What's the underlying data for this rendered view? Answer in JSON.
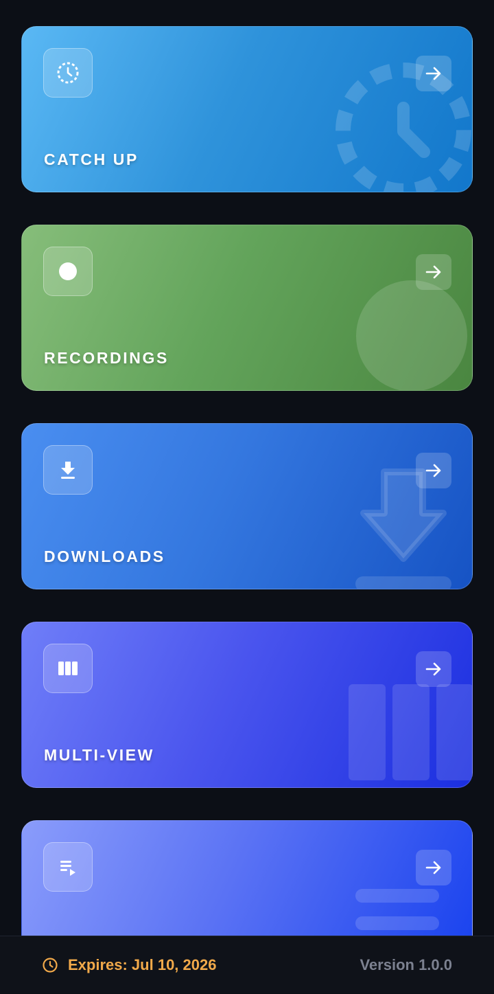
{
  "cards": [
    {
      "title": "CATCH UP",
      "icon": "clock-dashed-icon",
      "action_icon": "arrow-right-icon"
    },
    {
      "title": "RECORDINGS",
      "icon": "record-dot-icon",
      "action_icon": "arrow-right-icon"
    },
    {
      "title": "DOWNLOADS",
      "icon": "download-icon",
      "action_icon": "arrow-right-icon"
    },
    {
      "title": "MULTI-VIEW",
      "icon": "columns-icon",
      "action_icon": "arrow-right-icon"
    },
    {
      "title": "",
      "icon": "playlist-icon",
      "action_icon": "arrow-right-icon"
    }
  ],
  "footer": {
    "expiry": "Expires: Jul 10, 2026",
    "version": "Version 1.0.0"
  },
  "colors": {
    "background": "#0c0f16",
    "expiry_text": "#f1a94a",
    "version_text": "#7c8190"
  }
}
